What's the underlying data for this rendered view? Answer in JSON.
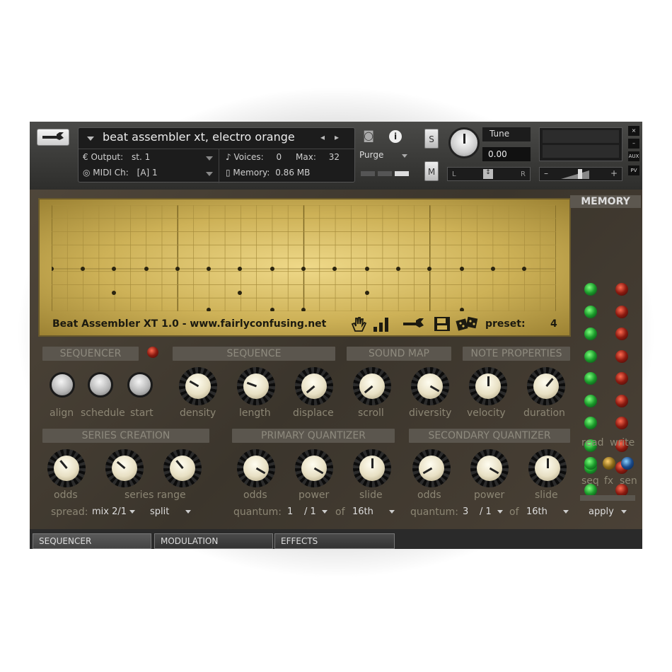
{
  "header": {
    "instrument_name": "beat assembler xt, electro orange",
    "output_label": "Output:",
    "output_value": "st. 1",
    "voices_label": "Voices:",
    "voices_value": "0",
    "max_label": "Max:",
    "max_value": "32",
    "midi_label": "MIDI Ch:",
    "midi_value": "[A] 1",
    "memory_label": "Memory:",
    "memory_value": "0.86 MB",
    "purge_label": "Purge",
    "solo_label": "S",
    "mute_label": "M",
    "tune_label": "Tune",
    "tune_value": "0.00",
    "pan_left": "L",
    "pan_right": "R",
    "side_buttons": [
      "×",
      "–",
      "AUX",
      "PV"
    ]
  },
  "screen": {
    "title": "Beat Assembler XT 1.0 - www.fairlyconfusing.net",
    "preset_label": "preset:",
    "preset_value": "4"
  },
  "memory": {
    "title": "MEMORY",
    "read_label": "read",
    "write_label": "write",
    "seq_label": "seq",
    "fx_label": "fx",
    "sen_label": "sen",
    "apply_label": "apply"
  },
  "sections": {
    "sequencer": "SEQUENCER",
    "sequence": "SEQUENCE",
    "sound_map": "SOUND MAP",
    "note_properties": "NOTE PROPERTIES",
    "series_creation": "SERIES CREATION",
    "primary_quantizer": "PRIMARY QUANTIZER",
    "secondary_quantizer": "SECONDARY QUANTIZER"
  },
  "controls": {
    "align": "align",
    "schedule": "schedule",
    "start": "start",
    "density": "density",
    "length": "length",
    "displace": "displace",
    "scroll": "scroll",
    "diversity": "diversity",
    "velocity": "velocity",
    "duration": "duration",
    "series_odds": "odds",
    "series_range": "series range",
    "spread_label": "spread:",
    "spread_value": "mix 2/1",
    "split_value": "split",
    "pq_odds": "odds",
    "pq_power": "power",
    "pq_slide": "slide",
    "pq_quantum_label": "quantum:",
    "pq_num": "1",
    "pq_den": "/ 1",
    "pq_of": "of",
    "pq_unit": "16th",
    "sq_odds": "odds",
    "sq_power": "power",
    "sq_slide": "slide",
    "sq_quantum_label": "quantum:",
    "sq_num": "3",
    "sq_den": "/ 1",
    "sq_of": "of",
    "sq_unit": "16th"
  },
  "tabs": [
    "SEQUENCER",
    "MODULATION",
    "EFFECTS"
  ],
  "colors": {
    "screen": "#cdb157",
    "led_green": "#1a9a2a",
    "led_red": "#8a1a10",
    "section_header": "#5b564e"
  }
}
